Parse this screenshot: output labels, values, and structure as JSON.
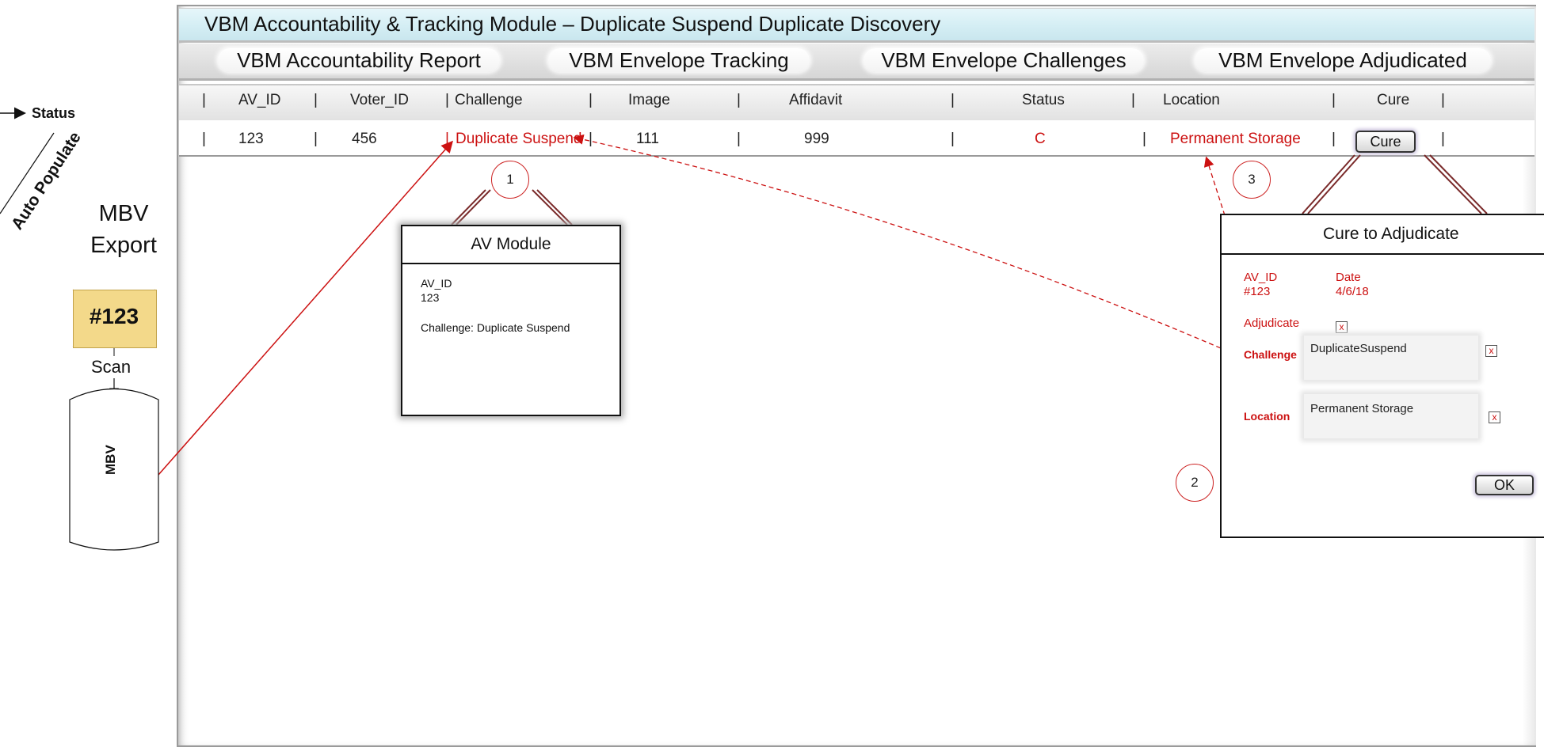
{
  "title": "VBM Accountability & Tracking Module – Duplicate Suspend Duplicate Discovery",
  "tabs": [
    {
      "label": "VBM Accountability Report"
    },
    {
      "label": "VBM Envelope Tracking"
    },
    {
      "label": "VBM Envelope Challenges"
    },
    {
      "label": "VBM Envelope Adjudicated"
    }
  ],
  "table": {
    "headers": [
      "AV_ID",
      "Voter_ID",
      "Challenge",
      "Image",
      "Affidavit",
      "Status",
      "Location",
      "Cure"
    ],
    "separator": "|",
    "row": {
      "av_id": "123",
      "voter_id": "456",
      "challenge": "Duplicate Suspend",
      "image": "111",
      "affidavit": "999",
      "status": "C",
      "location": "Permanent Storage",
      "cure_button": "Cure"
    }
  },
  "av_module": {
    "title": "AV Module",
    "id_label": "AV_ID",
    "id_value": "123",
    "challenge_line": "Challenge: Duplicate Suspend"
  },
  "cure_dialog": {
    "title": "Cure to Adjudicate",
    "av_id_label": "AV_ID",
    "av_id_value": "#123",
    "date_label": "Date",
    "date_value": "4/6/18",
    "adjudicate_label": "Adjudicate",
    "challenge_label": "Challenge",
    "challenge_value": "DuplicateSuspend",
    "location_label": "Location",
    "location_value": "Permanent Storage",
    "ok_label": "OK",
    "check_mark": "x"
  },
  "callouts": [
    "1",
    "2",
    "3"
  ],
  "side": {
    "status": "Status",
    "auto_populate": "Auto Populate",
    "mbv_export_line1": "MBV",
    "mbv_export_line2": "Export",
    "envelope_id": "#123",
    "scan": "Scan",
    "mbv_db": "MBV"
  },
  "colors": {
    "accent_red": "#cc1111",
    "title_bar": "#d4eef4",
    "envelope": "#f3d98a",
    "connector": "#7a2a2a"
  }
}
